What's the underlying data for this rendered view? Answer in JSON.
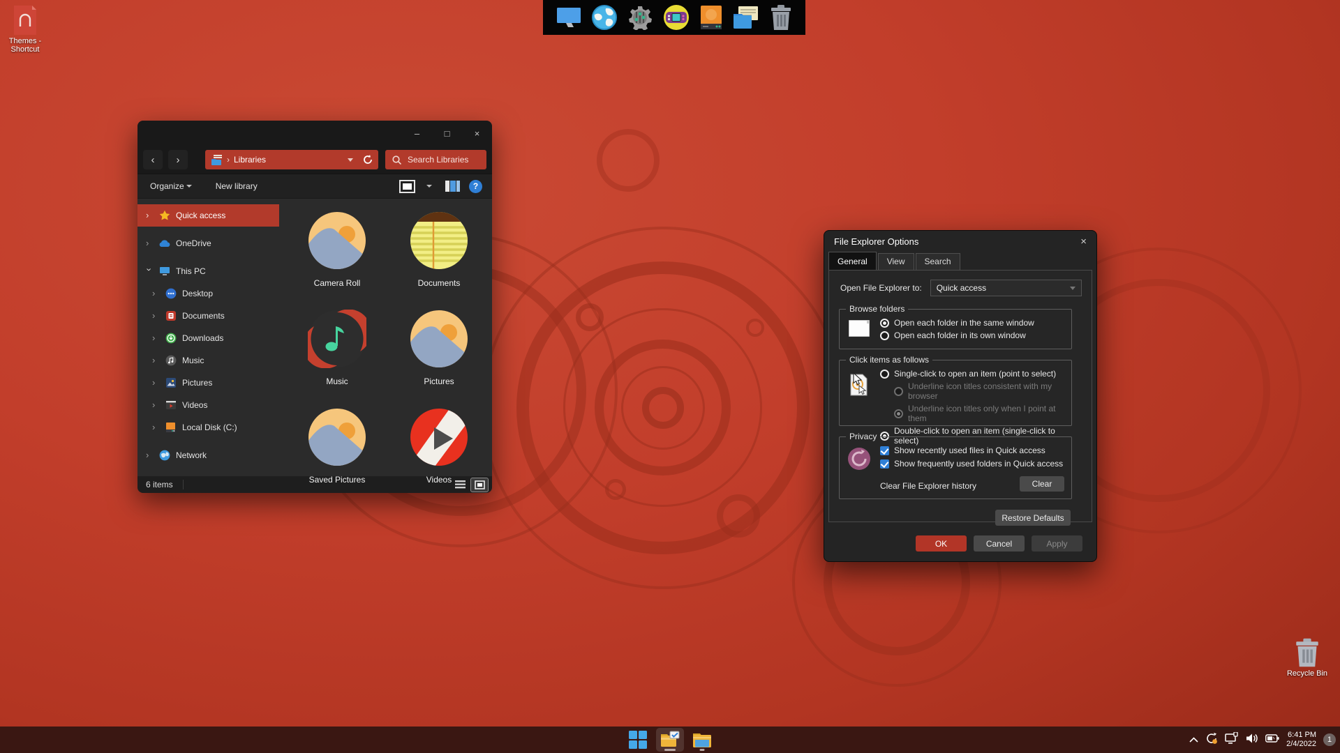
{
  "glyphs": {
    "back": "‹",
    "forward": "›",
    "crumb_sep": "›",
    "chev": "›",
    "minimize": "–",
    "maximize": "□",
    "close": "×",
    "help": "?"
  },
  "colors": {
    "accent_red": "#b23a2b",
    "wallpaper_red": "#c2402e",
    "taskbar": "#3a1712",
    "checkbox_blue": "#2f7fd6",
    "ok_button": "#b23527"
  },
  "desktop": {
    "themes_shortcut_label": "Themes - Shortcut",
    "recycle_bin_label": "Recycle Bin"
  },
  "dock": {
    "icons": [
      "display",
      "globe",
      "settings",
      "games",
      "hard-drive",
      "documents",
      "trash"
    ]
  },
  "explorer": {
    "address_value": "Libraries",
    "search_placeholder": "Search Libraries",
    "organize_label": "Organize",
    "new_library_label": "New library",
    "sidebar": [
      {
        "label": "Quick access"
      },
      {
        "label": "OneDrive"
      },
      {
        "label": "This PC"
      },
      {
        "label": "Desktop"
      },
      {
        "label": "Documents"
      },
      {
        "label": "Downloads"
      },
      {
        "label": "Music"
      },
      {
        "label": "Pictures"
      },
      {
        "label": "Videos"
      },
      {
        "label": "Local Disk (C:)"
      },
      {
        "label": "Network"
      }
    ],
    "tiles": [
      {
        "name": "Camera Roll"
      },
      {
        "name": "Documents"
      },
      {
        "name": "Music"
      },
      {
        "name": "Pictures"
      },
      {
        "name": "Saved Pictures"
      },
      {
        "name": "Videos"
      }
    ],
    "status_items": "6 items"
  },
  "dialog": {
    "title": "File Explorer Options",
    "tabs": [
      {
        "label": "General"
      },
      {
        "label": "View"
      },
      {
        "label": "Search"
      }
    ],
    "open_to_label": "Open File Explorer to:",
    "open_to_value": "Quick access",
    "browse_legend": "Browse folders",
    "browse_option_same": "Open each folder in the same window",
    "browse_option_own": "Open each folder in its own window",
    "click_legend": "Click items as follows",
    "click_single": "Single-click to open an item (point to select)",
    "click_underline_browser": "Underline icon titles consistent with my browser",
    "click_underline_point": "Underline icon titles only when I point at them",
    "click_double": "Double-click to open an item (single-click to select)",
    "privacy_legend": "Privacy",
    "privacy_recent": "Show recently used files in Quick access",
    "privacy_frequent": "Show frequently used folders in Quick access",
    "clear_history_label": "Clear File Explorer history",
    "clear_button": "Clear",
    "restore_defaults": "Restore Defaults",
    "ok": "OK",
    "cancel": "Cancel",
    "apply": "Apply"
  },
  "taskbar": {
    "time": "6:41 PM",
    "date": "2/4/2022",
    "notification_count": "1"
  }
}
